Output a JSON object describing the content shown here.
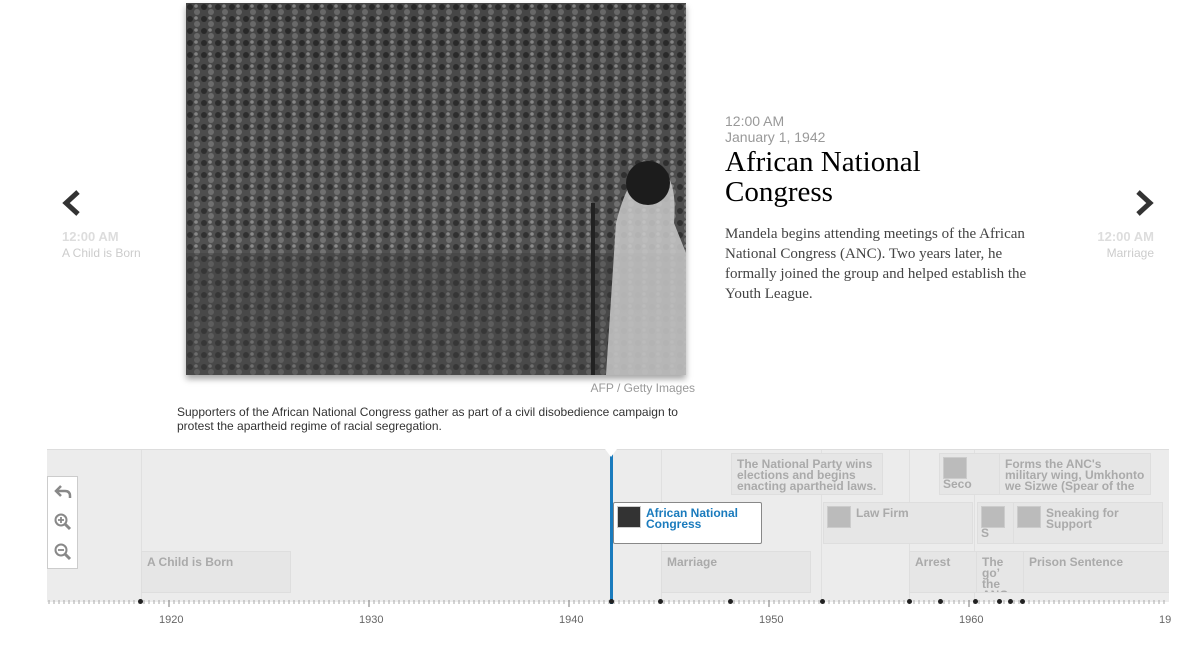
{
  "slide": {
    "time": "12:00 AM",
    "date": "January 1, 1942",
    "headline": "African National Congress",
    "body": "Mandela begins attending meetings of the African National Congress (ANC). Two years later, he formally joined the group and helped establish the Youth League.",
    "credit": "AFP / Getty Images",
    "caption": "Supporters of the African National Congress gather as part of a civil disobedience campaign to protest the apartheid regime of racial segregation."
  },
  "nav": {
    "prev": {
      "time": "12:00 AM",
      "title": "A Child is Born",
      "icon": "chevron-left-icon"
    },
    "next": {
      "time": "12:00 AM",
      "title": "Marriage",
      "icon": "chevron-right-icon"
    }
  },
  "timeline": {
    "markers": [
      {
        "id": "child",
        "title": "A Child is Born"
      },
      {
        "id": "anc",
        "title": "African National Congress",
        "active": true
      },
      {
        "id": "marriage",
        "title": "Marriage"
      },
      {
        "id": "national-party",
        "title": "The National Party wins elections and begins enacting apartheid laws."
      },
      {
        "id": "law-firm",
        "title": "Law Firm"
      },
      {
        "id": "arrest",
        "title": "Arrest"
      },
      {
        "id": "second",
        "title": "Seco"
      },
      {
        "id": "forms-anc",
        "title": "Forms the ANC's military wing, Umkhonto we Sizwe (Spear of the"
      },
      {
        "id": "small",
        "title": "S"
      },
      {
        "id": "sneaking",
        "title": "Sneaking for Support"
      },
      {
        "id": "gov",
        "title": "The go’ the ANC state of"
      },
      {
        "id": "prison",
        "title": "Prison Sentence"
      }
    ],
    "controls": {
      "back_icon": "back-arrow-icon",
      "zoom_in_icon": "zoom-in-icon",
      "zoom_out_icon": "zoom-out-icon"
    },
    "axis_labels": [
      "1920",
      "1930",
      "1940",
      "1950",
      "1960",
      "19"
    ],
    "accent": "#1a7bbd"
  }
}
